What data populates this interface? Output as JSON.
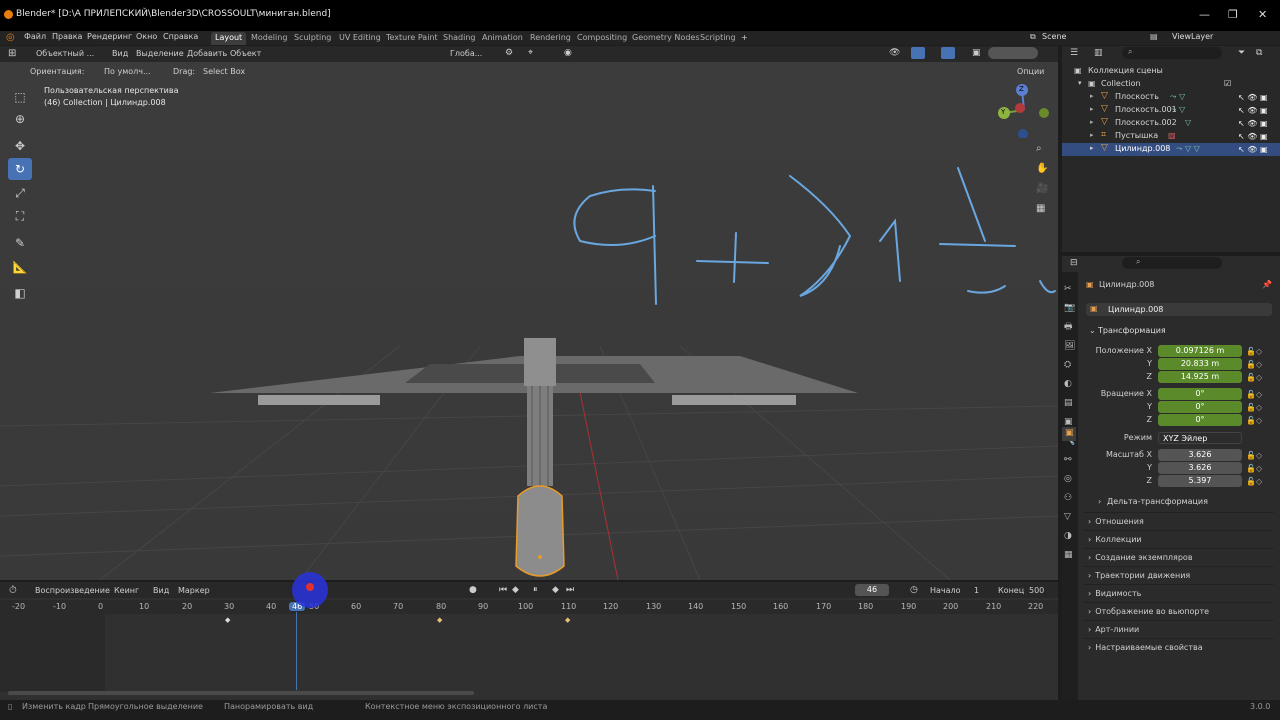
{
  "window": {
    "title": "Blender* [D:\\А ПРИЛЕПСКИЙ\\Blender3D\\CROSSOULT\\миниган.blend]",
    "controls": [
      "—",
      "❐",
      "✕"
    ]
  },
  "menu": [
    "Файл",
    "Правка",
    "Рендеринг",
    "Окно",
    "Справка"
  ],
  "workspaces": [
    "Layout",
    "Modeling",
    "Sculpting",
    "UV Editing",
    "Texture Paint",
    "Shading",
    "Animation",
    "Rendering",
    "Compositing",
    "Geometry Nodes",
    "Scripting"
  ],
  "workspace_active": "Layout",
  "workspace_add": "+",
  "scene": {
    "name": "Scene",
    "view_layer": "ViewLayer"
  },
  "viewport_header": {
    "mode": "Объектный ...",
    "menus": [
      "Вид",
      "Выделение",
      "Добавить",
      "Объект"
    ],
    "transform": "Глоба...",
    "options": "Опции"
  },
  "viewport_header2": {
    "orientation_label": "Ориентация:",
    "orientation_value": "По умолч...",
    "drag_label": "Drag:",
    "drag_value": "Select Box"
  },
  "viewport_info": {
    "line1": "Пользовательская перспектива",
    "line2": "(46) Collection | Цилиндр.008"
  },
  "nav_gizmo": {
    "x": "X",
    "y": "Y",
    "z": "Z"
  },
  "timeline": {
    "menus": [
      "Воспроизведение",
      "Кеинг",
      "Вид",
      "Маркер"
    ],
    "current_frame": "46",
    "start_label": "Начало",
    "start_value": "1",
    "end_label": "Конец",
    "end_value": "500",
    "ticks": [
      "-20",
      "-10",
      "0",
      "10",
      "20",
      "30",
      "40",
      "46",
      "50",
      "60",
      "70",
      "80",
      "90",
      "100",
      "110",
      "120",
      "130",
      "140",
      "150",
      "160",
      "170",
      "180",
      "190",
      "200",
      "210",
      "220"
    ]
  },
  "status": {
    "items": [
      "Изменить кадр",
      "Прямоугольное выделение",
      "Панорамировать вид",
      "Контекстное меню экспозиционного листа"
    ],
    "version": "3.0.0"
  },
  "outliner": {
    "root": "Коллекция сцены",
    "collection": "Collection",
    "items": [
      "Плоскость",
      "Плоскость.001",
      "Плоскость.002",
      "Пустышка",
      "Цилиндр.008"
    ],
    "selected": "Цилиндр.008"
  },
  "properties": {
    "object_name": "Цилиндр.008",
    "object_field": "Цилиндр.008",
    "transform_title": "Трансформация",
    "location_label": "Положение X",
    "location": [
      "0.097126 m",
      "20.833 m",
      "14.925 m"
    ],
    "rotation_label": "Вращение X",
    "rotation": [
      "0°",
      "0°",
      "0°"
    ],
    "mode_label": "Режим",
    "mode_value": "XYZ Эйлер",
    "scale_label": "Масштаб X",
    "scale": [
      "3.626",
      "3.626",
      "5.397"
    ],
    "axis_y": "Y",
    "axis_z": "Z",
    "delta": "Дельта-трансформация",
    "panels": [
      "Отношения",
      "Коллекции",
      "Создание экземпляров",
      "Траектории движения",
      "Видимость",
      "Отображение во вьюпорте",
      "Арт-линии",
      "Настраиваемые свойства"
    ]
  },
  "colors": {
    "accent": "#4772b3",
    "selected_row": "#334d80",
    "field_green": "#5b8a2a",
    "annotation": "#6aa7e0",
    "selection_orange": "#e89b2a"
  }
}
